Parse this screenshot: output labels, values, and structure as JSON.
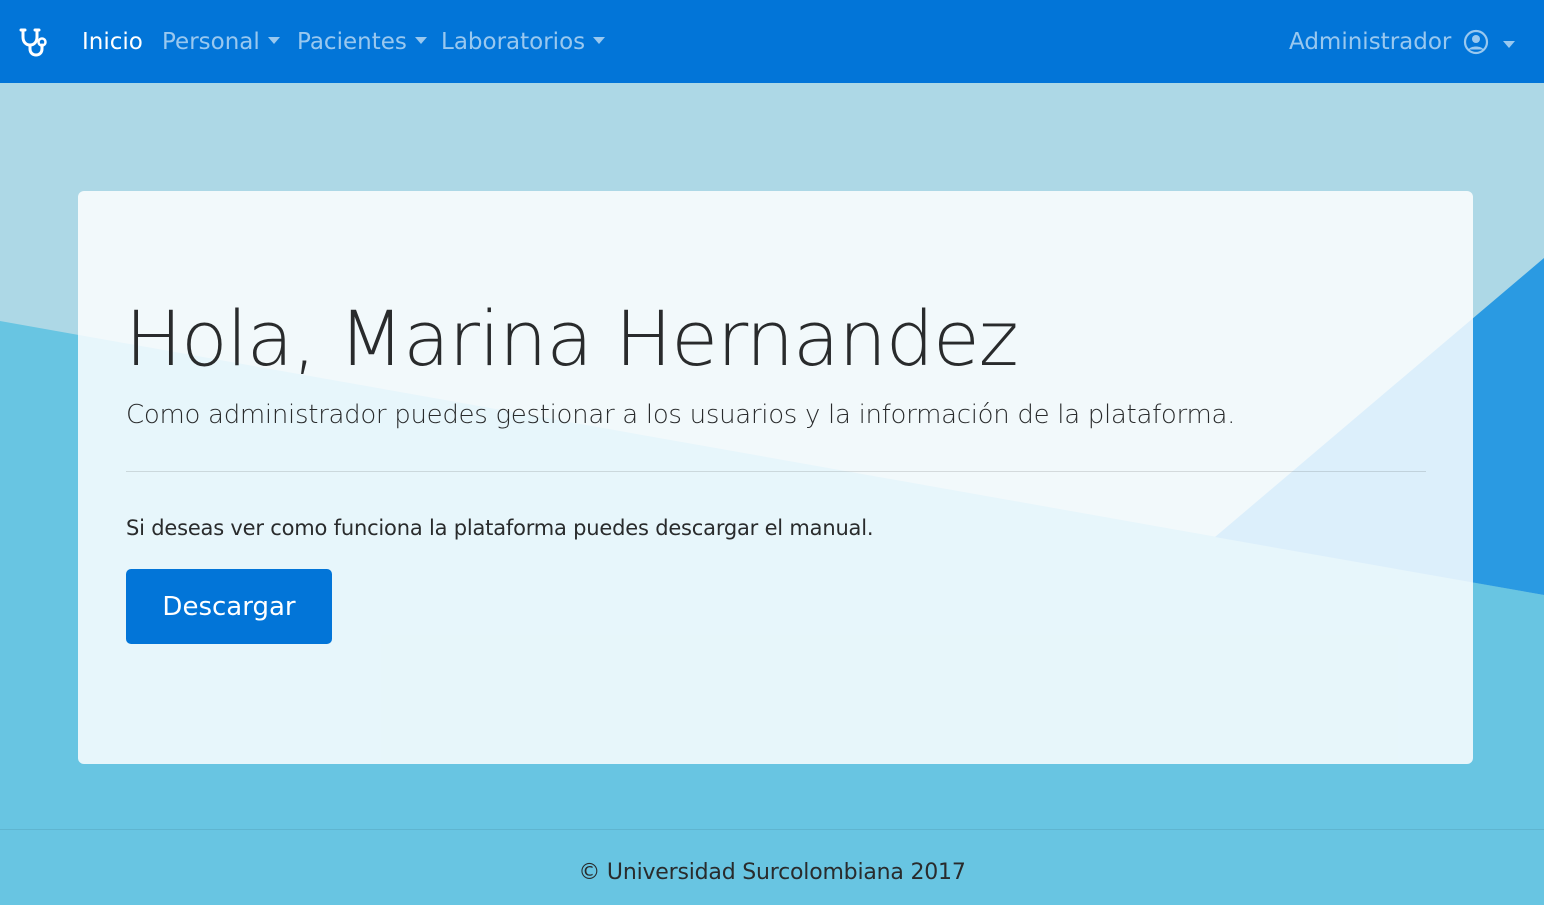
{
  "navbar": {
    "brand_icon": "stethoscope-icon",
    "items": [
      {
        "label": "Inicio",
        "active": true,
        "dropdown": false
      },
      {
        "label": "Personal",
        "active": false,
        "dropdown": true
      },
      {
        "label": "Pacientes",
        "active": false,
        "dropdown": true
      },
      {
        "label": "Laboratorios",
        "active": false,
        "dropdown": true
      }
    ],
    "role_label": "Administrador",
    "user_icon": "user-circle-icon"
  },
  "jumbotron": {
    "greeting": "Hola, Marina Hernandez",
    "lead": "Como administrador puedes gestionar a los usuarios y la información de la plataforma.",
    "info": "Si deseas ver como funciona la plataforma puedes descargar el manual.",
    "button_label": "Descargar"
  },
  "footer": {
    "text": "© Universidad Surcolombiana 2017"
  },
  "colors": {
    "navbar": "#0275d8",
    "background_light": "#add8e6",
    "background_mid": "#68c5e2",
    "accent_triangle": "#2a9ae2",
    "button": "#0275d8"
  }
}
